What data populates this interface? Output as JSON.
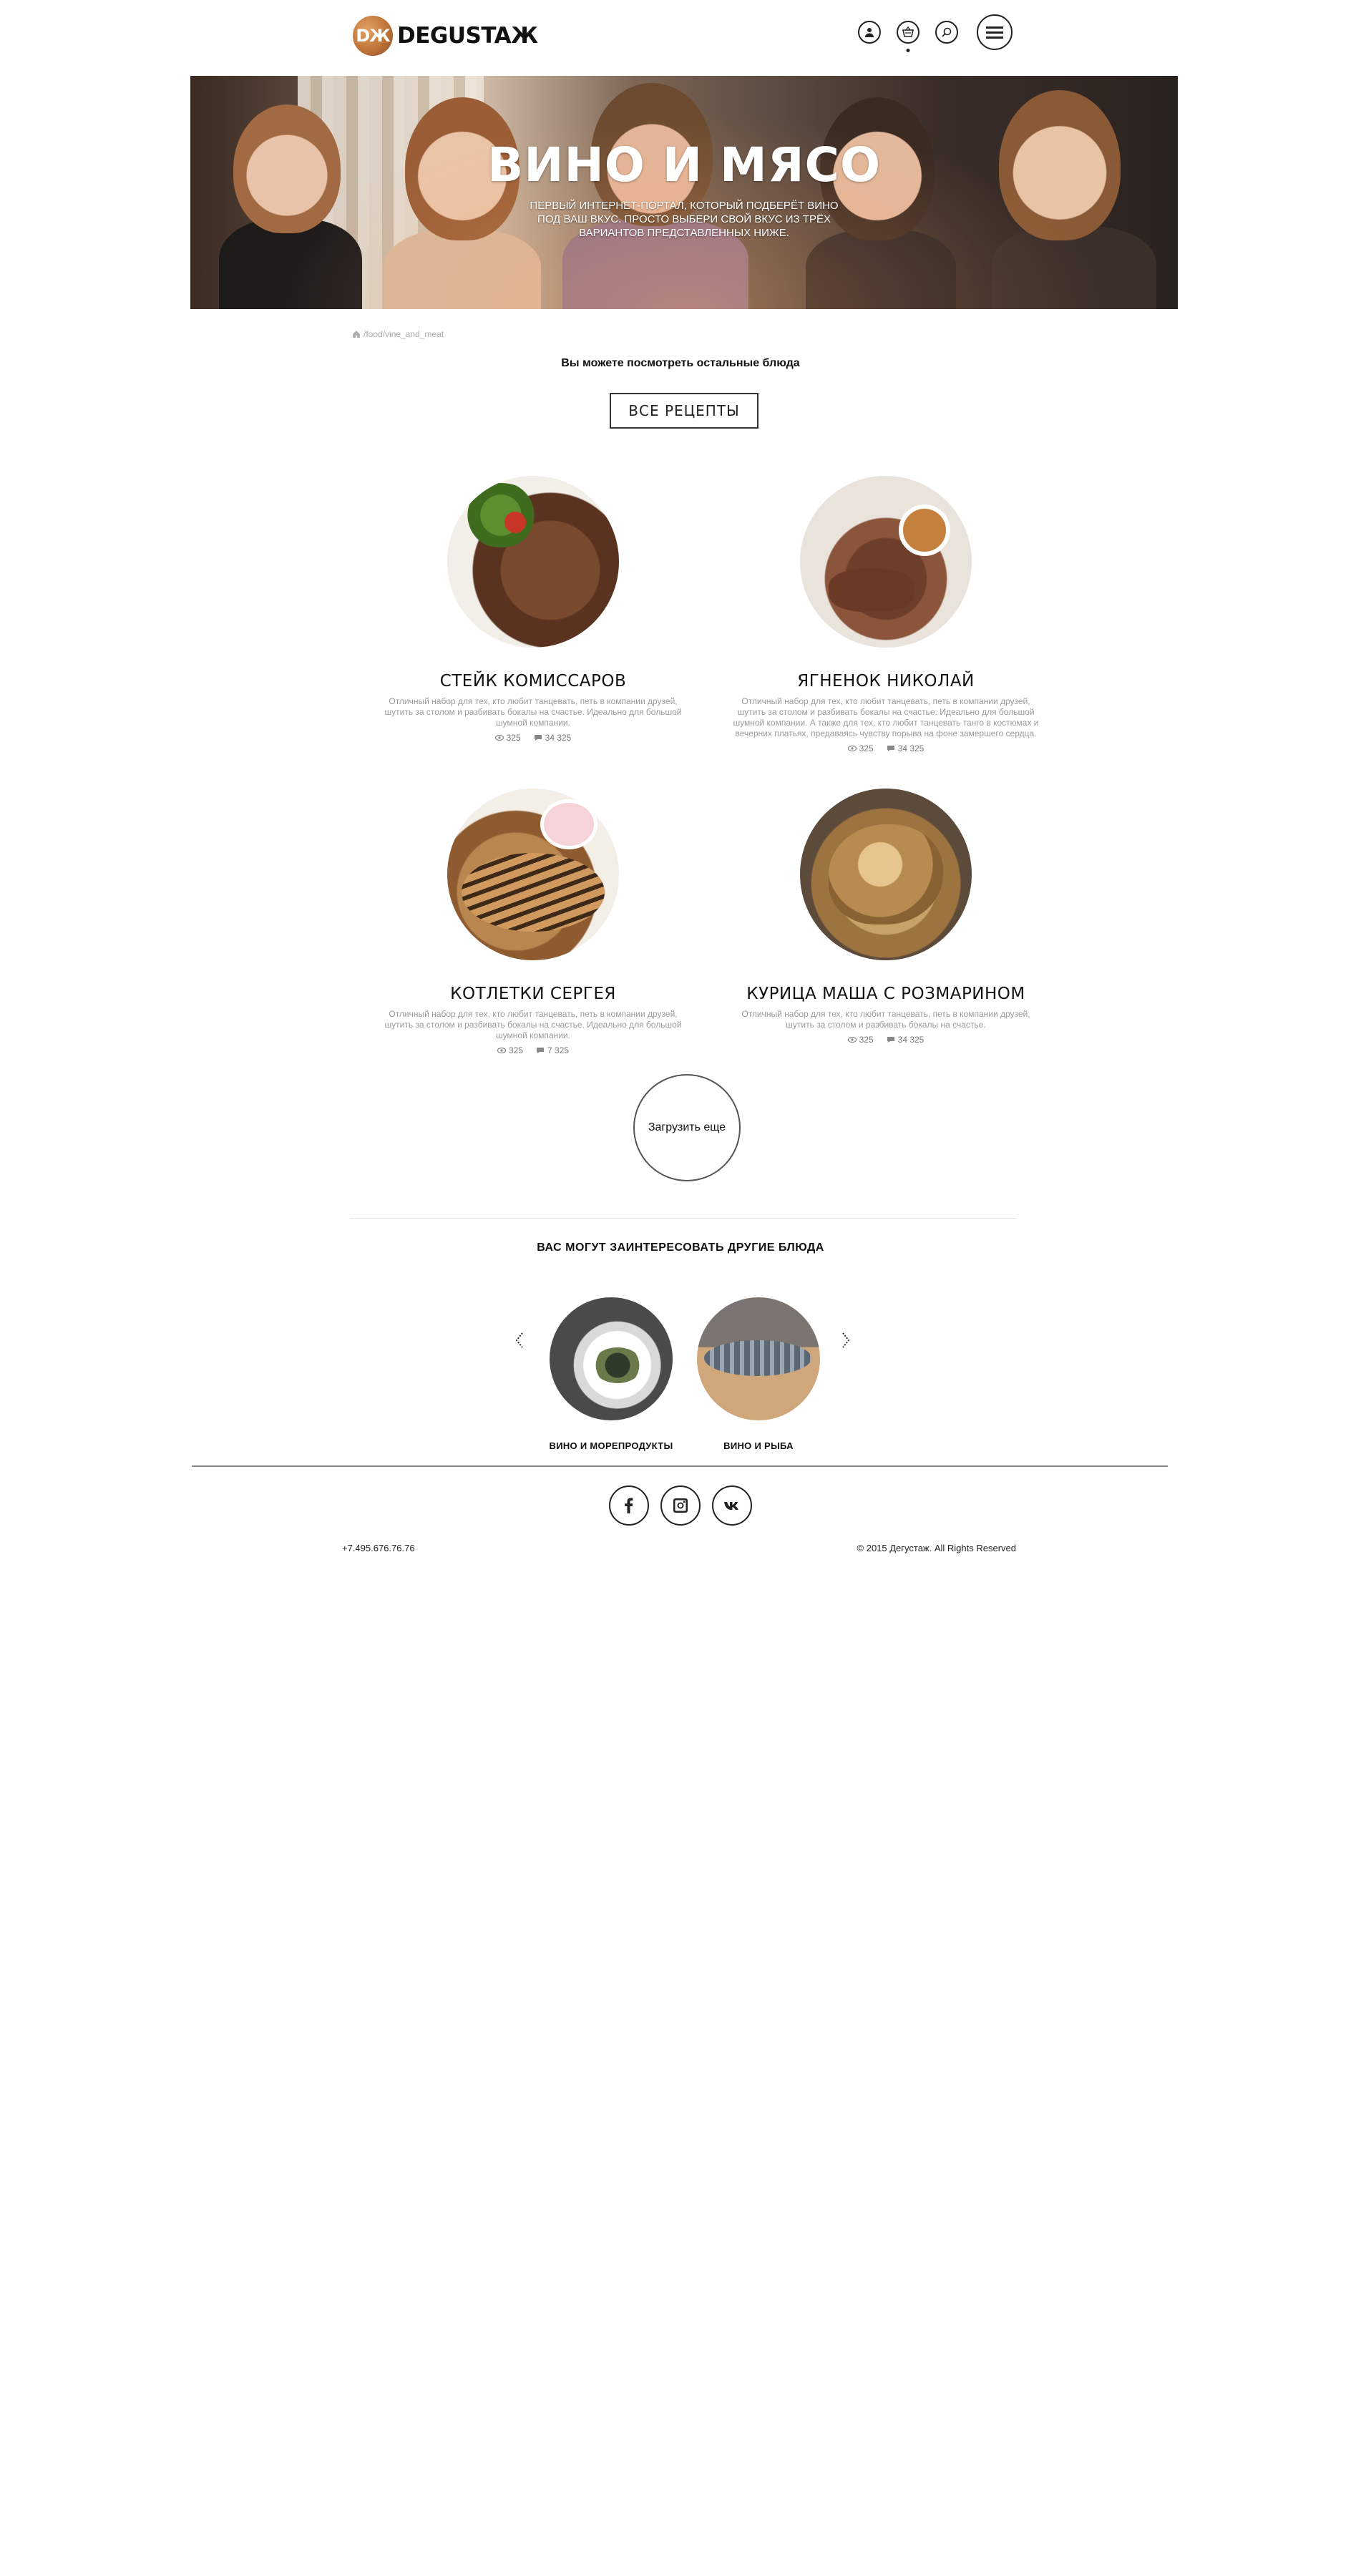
{
  "header": {
    "logo_badge": "DЖ",
    "logo_text": "DEGUSTAЖ",
    "icons": [
      "user-icon",
      "cart-icon",
      "search-icon",
      "menu-icon"
    ]
  },
  "hero": {
    "title": "ВИНО И МЯСО",
    "subtitle": "ПЕРВЫЙ ИНТЕРНЕТ-ПОРТАЛ, КОТОРЫЙ ПОДБЕРЁТ ВИНО ПОД ВАШ ВКУС. ПРОСТО ВЫБЕРИ СВОЙ ВКУС ИЗ ТРЁХ ВАРИАНТОВ ПРЕДСТАВЛЕННЫХ НИЖЕ."
  },
  "breadcrumb": "/food/vine_and_meat",
  "intro": "Вы можете посмотреть остальные блюда",
  "all_recipes_label": "ВСЕ РЕЦЕПТЫ",
  "dishes": [
    {
      "title": "СТЕЙК КОМИССАРОВ",
      "desc": "Отличный набор для тех, кто любит танцевать, петь в компании друзей, шутить за столом и разбивать бокалы на счастье. Идеально для большой шумной компании.",
      "views": "325",
      "comments": "34 325"
    },
    {
      "title": "ЯГНЕНОК НИКОЛАЙ",
      "desc": "Отличный набор для тех, кто любит танцевать, петь в компании друзей, шутить за столом и разбивать бокалы на счастье. Идеально для большой шумной компании. А также для тех, кто любит танцевать танго в костюмах и вечерних платьях, предаваясь чувству порыва на фоне замершего сердца.",
      "views": "325",
      "comments": "34 325"
    },
    {
      "title": "КОТЛЕТКИ СЕРГЕЯ",
      "desc": "Отличный набор для тех, кто любит танцевать, петь в компании друзей, шутить за столом и разбивать бокалы на счастье. Идеально для большой шумной компании.",
      "views": "325",
      "comments": "7 325"
    },
    {
      "title": "КУРИЦА МАША С РОЗМАРИНОМ",
      "desc": "Отличный набор для тех, кто любит танцевать, петь в компании друзей, шутить за столом и разбивать бокалы на счастье.",
      "views": "325",
      "comments": "34 325"
    }
  ],
  "load_more_label": "Загрузить еще",
  "related": {
    "title": "ВАС МОГУТ ЗАИНТЕРЕСОВАТЬ ДРУГИЕ БЛЮДА",
    "items": [
      {
        "label": "ВИНО И МОРЕПРОДУКТЫ"
      },
      {
        "label": "ВИНО И РЫБА"
      }
    ]
  },
  "footer": {
    "socials": [
      "facebook-icon",
      "instagram-icon",
      "vk-icon"
    ],
    "phone": "+7.495.676.76.76",
    "copyright": "© 2015 Дегустаж. All Rights Reserved"
  }
}
